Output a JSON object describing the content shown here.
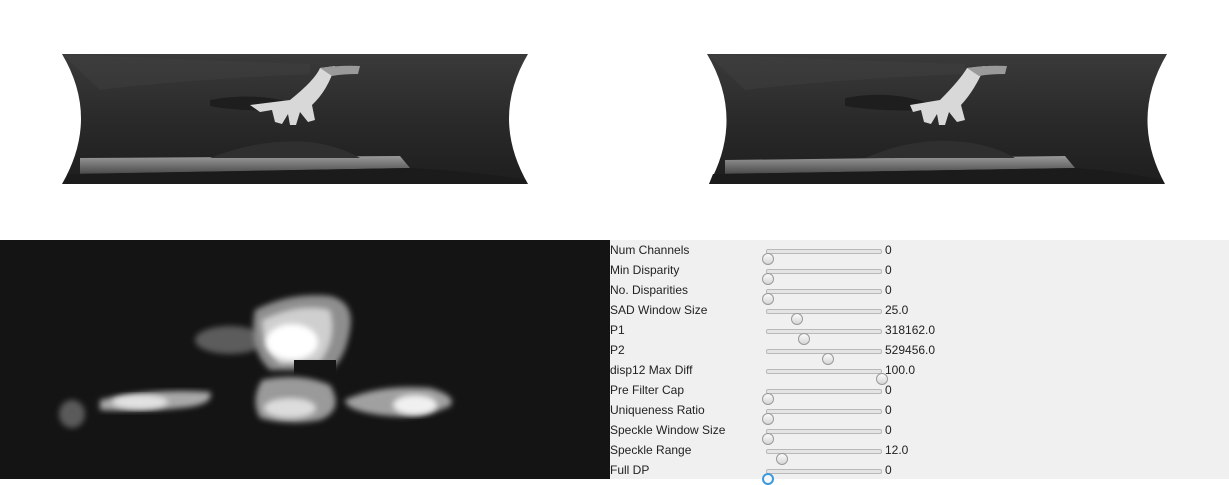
{
  "images": {
    "left": "left-rectified-camera-image",
    "right": "right-rectified-camera-image",
    "disparity": "disparity-map"
  },
  "params": [
    {
      "key": "num_channels",
      "label": "Num Channels",
      "value": "0",
      "fraction": 0.0
    },
    {
      "key": "min_disparity",
      "label": "Min Disparity",
      "value": "0",
      "fraction": 0.0
    },
    {
      "key": "num_disparities",
      "label": "No. Disparities",
      "value": "0",
      "fraction": 0.0
    },
    {
      "key": "sad_window_size",
      "label": "SAD Window Size",
      "value": "25.0",
      "fraction": 0.25
    },
    {
      "key": "p1",
      "label": "P1",
      "value": "318162.0",
      "fraction": 0.32
    },
    {
      "key": "p2",
      "label": "P2",
      "value": "529456.0",
      "fraction": 0.53
    },
    {
      "key": "disp12_max_diff",
      "label": "disp12 Max Diff",
      "value": "100.0",
      "fraction": 1.0
    },
    {
      "key": "pre_filter_cap",
      "label": "Pre Filter Cap",
      "value": "0",
      "fraction": 0.0
    },
    {
      "key": "uniqueness_ratio",
      "label": "Uniqueness Ratio",
      "value": "0",
      "fraction": 0.0
    },
    {
      "key": "speckle_window_size",
      "label": "Speckle Window Size",
      "value": "0",
      "fraction": 0.0
    },
    {
      "key": "speckle_range",
      "label": "Speckle Range",
      "value": "12.0",
      "fraction": 0.12
    },
    {
      "key": "full_dp",
      "label": "Full DP",
      "value": "0",
      "fraction": 0.0
    }
  ]
}
